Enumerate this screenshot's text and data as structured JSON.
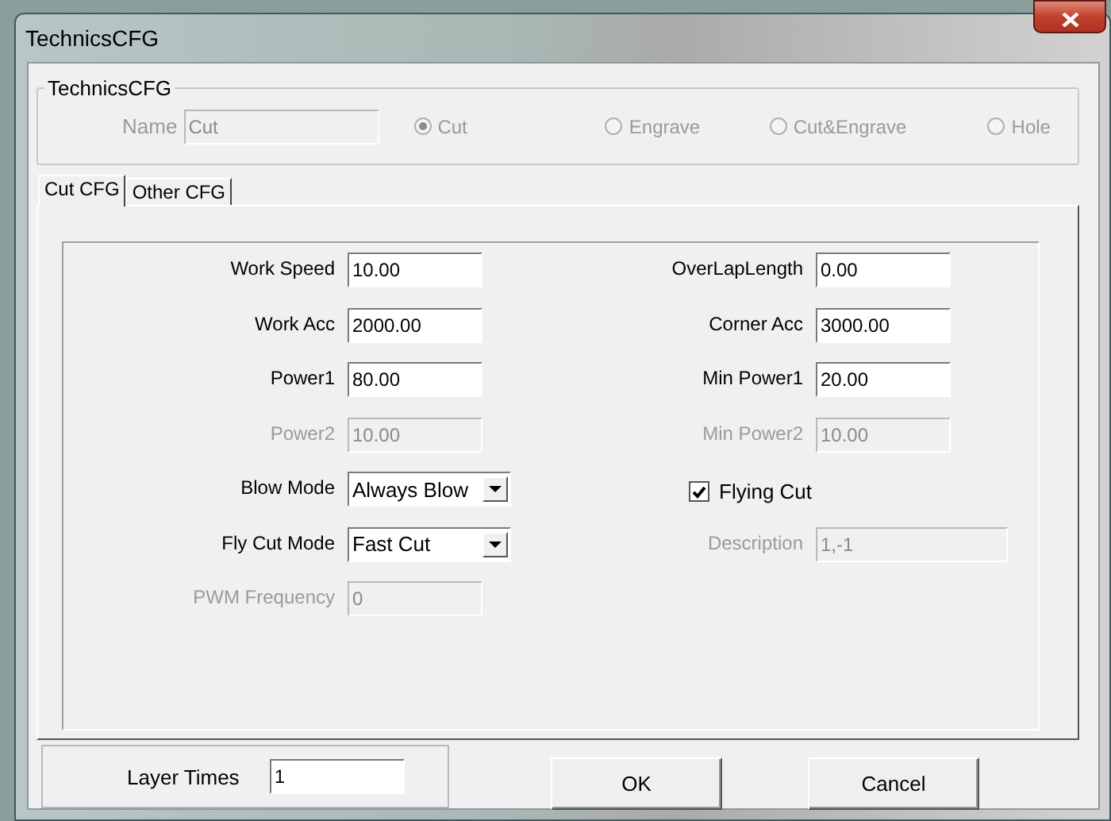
{
  "window": {
    "title": "TechnicsCFG"
  },
  "group": {
    "title": "TechnicsCFG",
    "name_label": "Name",
    "name_value": "Cut",
    "disabled": true,
    "options": [
      {
        "label": "Cut",
        "selected": true
      },
      {
        "label": "Engrave",
        "selected": false
      },
      {
        "label": "Cut&Engrave",
        "selected": false
      },
      {
        "label": "Hole",
        "selected": false
      }
    ]
  },
  "tabs": [
    {
      "label": "Cut CFG",
      "selected": true
    },
    {
      "label": "Other CFG",
      "selected": false
    }
  ],
  "rows": [
    {
      "left": {
        "kind": "text",
        "label": "Work Speed",
        "value": "10.00",
        "disabled": false
      },
      "right": {
        "kind": "text",
        "label": "OverLapLength",
        "value": "0.00",
        "disabled": false
      }
    },
    {
      "left": {
        "kind": "text",
        "label": "Work Acc",
        "value": "2000.00",
        "disabled": false
      },
      "right": {
        "kind": "text",
        "label": "Corner Acc",
        "value": "3000.00",
        "disabled": false
      }
    },
    {
      "left": {
        "kind": "text",
        "label": "Power1",
        "value": "80.00",
        "disabled": false
      },
      "right": {
        "kind": "text",
        "label": "Min Power1",
        "value": "20.00",
        "disabled": false
      }
    },
    {
      "left": {
        "kind": "text",
        "label": "Power2",
        "value": "10.00",
        "disabled": true
      },
      "right": {
        "kind": "text",
        "label": "Min Power2",
        "value": "10.00",
        "disabled": true
      }
    },
    {
      "left": {
        "kind": "dropdown",
        "label": "Blow Mode",
        "value": "Always Blow",
        "disabled": false
      },
      "right": {
        "kind": "checkbox",
        "label": "Flying Cut",
        "checked": true
      }
    },
    {
      "left": {
        "kind": "dropdown",
        "label": "Fly Cut Mode",
        "value": "Fast Cut",
        "disabled": false
      },
      "right": {
        "kind": "wide",
        "label": "Description",
        "value": "1,-1",
        "disabled": true
      }
    },
    {
      "left": {
        "kind": "text",
        "label": "PWM Frequency",
        "value": "0",
        "disabled": true
      }
    }
  ],
  "layer_times": {
    "label": "Layer Times",
    "value": "1"
  },
  "buttons": [
    "OK",
    "Cancel"
  ]
}
